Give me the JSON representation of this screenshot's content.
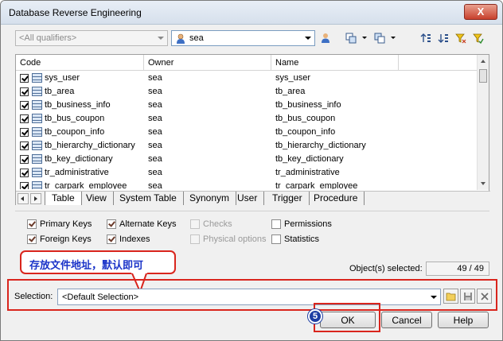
{
  "window": {
    "title": "Database Reverse Engineering",
    "close_label": "X"
  },
  "toolbar": {
    "qualifier_placeholder": "<All qualifiers>",
    "owner_value": "sea"
  },
  "grid": {
    "columns": [
      "Code",
      "Owner",
      "Name"
    ],
    "rows": [
      {
        "code": "sys_user",
        "owner": "sea",
        "name": "sys_user"
      },
      {
        "code": "tb_area",
        "owner": "sea",
        "name": "tb_area"
      },
      {
        "code": "tb_business_info",
        "owner": "sea",
        "name": "tb_business_info"
      },
      {
        "code": "tb_bus_coupon",
        "owner": "sea",
        "name": "tb_bus_coupon"
      },
      {
        "code": "tb_coupon_info",
        "owner": "sea",
        "name": "tb_coupon_info"
      },
      {
        "code": "tb_hierarchy_dictionary",
        "owner": "sea",
        "name": "tb_hierarchy_dictionary"
      },
      {
        "code": "tb_key_dictionary",
        "owner": "sea",
        "name": "tb_key_dictionary"
      },
      {
        "code": "tr_administrative",
        "owner": "sea",
        "name": "tr_administrative"
      },
      {
        "code": "tr_carpark_employee",
        "owner": "sea",
        "name": "tr_carpark_employee"
      }
    ],
    "tabs": [
      "Table",
      "View",
      "System Table",
      "Synonym",
      "User",
      "Trigger",
      "Procedure"
    ],
    "active_tab": "Table"
  },
  "options": {
    "primary_keys": "Primary Keys",
    "foreign_keys": "Foreign Keys",
    "alternate_keys": "Alternate Keys",
    "indexes": "Indexes",
    "checks": "Checks",
    "physical_options": "Physical options",
    "permissions": "Permissions",
    "statistics": "Statistics"
  },
  "annotation": {
    "callout": "存放文件地址，默认即可",
    "step_badge": "5"
  },
  "status": {
    "objects_selected_label": "Object(s) selected:",
    "objects_selected_value": "49 / 49"
  },
  "selection": {
    "label": "Selection:",
    "value": "<Default Selection>"
  },
  "buttons": {
    "ok": "OK",
    "cancel": "Cancel",
    "help": "Help"
  },
  "colors": {
    "annotation_red": "#d9251d",
    "callout_text": "#1a33c8",
    "badge_blue": "#1e3fa3"
  }
}
